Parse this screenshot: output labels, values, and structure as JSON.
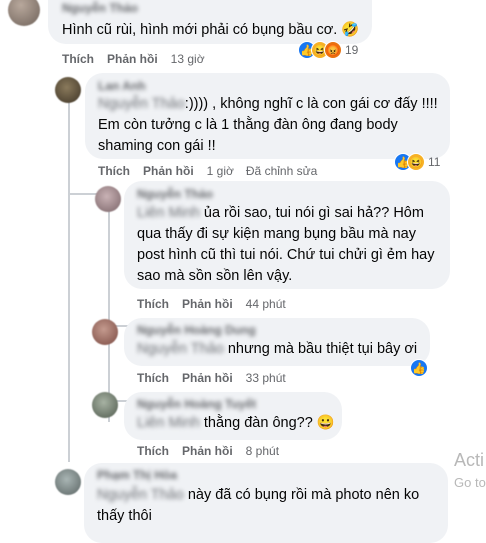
{
  "comments": [
    {
      "name": "Nguyễn Thảo",
      "text": "Hình cũ rùi, hình mới phải có bụng bầu cơ. 🤣",
      "actions": {
        "like": "Thích",
        "reply": "Phản hồi",
        "time": "13 giờ"
      },
      "reactions": {
        "icons": [
          "like-icon",
          "haha-icon",
          "angry-icon"
        ],
        "count": "19"
      }
    },
    {
      "name": "Lan Anh",
      "mention": "Nguyễn Thảo",
      "text_line1": ":)))) , không nghĩ c là con gái cơ đấy !!!!",
      "text_line2": "Em còn tưởng c là 1 thằng đàn ông đang body",
      "text_line3": "shaming con gái !!",
      "actions": {
        "like": "Thích",
        "reply": "Phản hồi",
        "time": "1 giờ",
        "edited": "Đã chỉnh sửa"
      },
      "reactions": {
        "icons": [
          "like-icon",
          "haha-icon"
        ],
        "count": "11"
      }
    },
    {
      "name": "Nguyễn Thảo",
      "mention": "Liên Minh",
      "text_line1": " ủa rồi sao, tui nói gì sai hả?? Hôm",
      "text_line2": "qua thấy đi sự kiện mang bụng bầu mà nay",
      "text_line3": "post hình cũ thì tui nói. Chứ tui chửi gì ẻm hay",
      "text_line4": "sao mà sồn sồn lên vậy.",
      "actions": {
        "like": "Thích",
        "reply": "Phản hồi",
        "time": "44 phút"
      }
    },
    {
      "name": "Nguyễn Hoàng Dung",
      "mention": "Nguyễn Thảo",
      "text": "nhưng mà bầu thiệt tụi bây ơi",
      "actions": {
        "like": "Thích",
        "reply": "Phản hồi",
        "time": "33 phút"
      },
      "reactions": {
        "icons": [
          "like-icon"
        ],
        "count": ""
      }
    },
    {
      "name": "Nguyễn Hoàng Tuyết",
      "mention": "Liên Minh",
      "text": " thằng đàn ông?? 😀",
      "actions": {
        "like": "Thích",
        "reply": "Phản hồi",
        "time": "8 phút"
      }
    },
    {
      "name": "Phạm Thị Hòa",
      "mention": "Nguyễn Thảo",
      "text_line1": " này đã có bụng rồi mà photo nên ko",
      "text_line2": "thấy thôi"
    }
  ],
  "watermark": {
    "line1": "Acti",
    "line2": "Go to"
  }
}
